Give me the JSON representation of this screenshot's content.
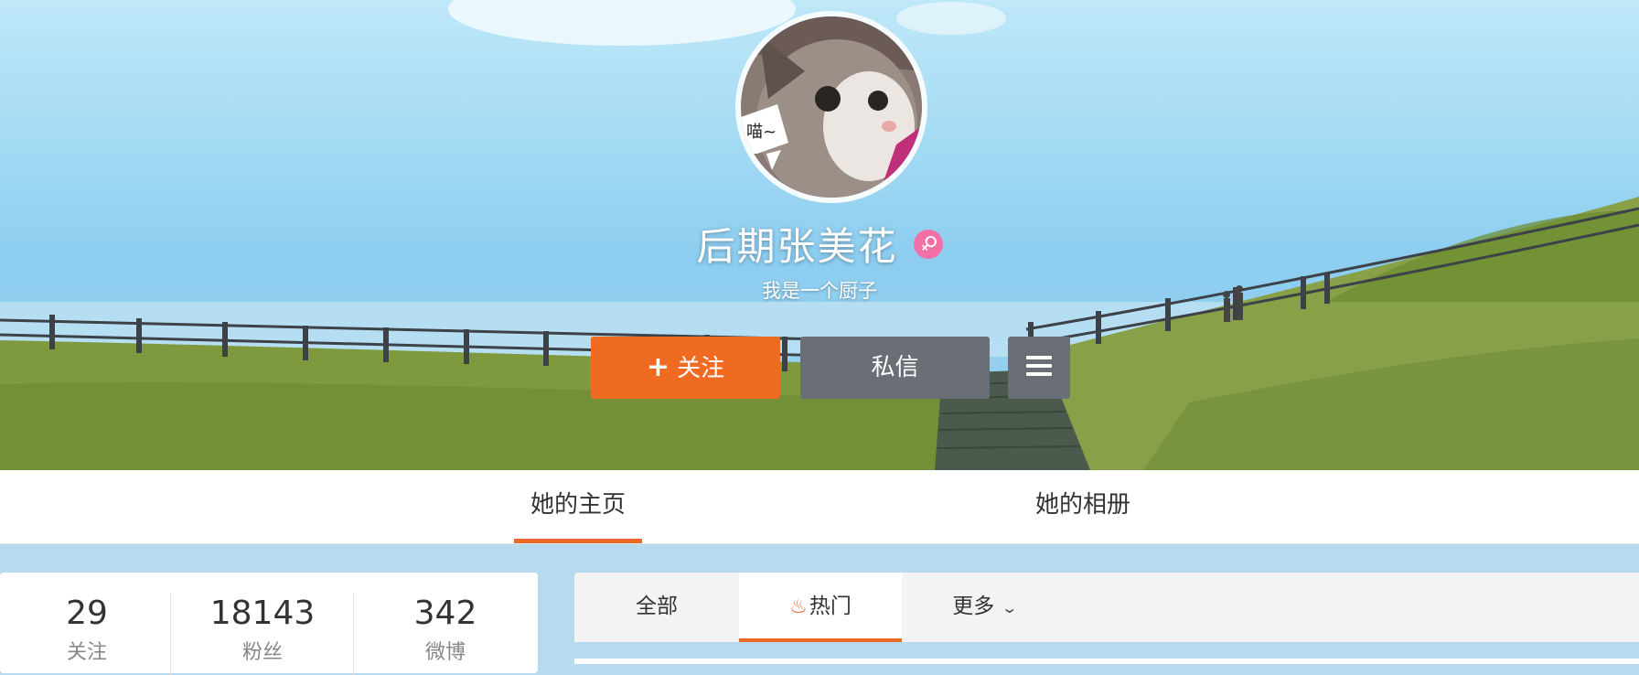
{
  "profile": {
    "name": "后期张美花",
    "bio": "我是一个厨子",
    "avatar_bubble_text": "喵~",
    "gender_icon": "female-icon"
  },
  "actions": {
    "follow_label": "关注",
    "follow_plus": "+",
    "message_label": "私信",
    "more_icon": "hamburger-menu-icon"
  },
  "nav": {
    "tabs": [
      {
        "label": "她的主页",
        "active": true
      },
      {
        "label": "她的相册",
        "active": false
      }
    ]
  },
  "stats": [
    {
      "value": "29",
      "label": "关注"
    },
    {
      "value": "18143",
      "label": "粉丝"
    },
    {
      "value": "342",
      "label": "微博"
    }
  ],
  "feed": {
    "tabs": [
      {
        "label": "全部",
        "active": false
      },
      {
        "label": "热门",
        "active": true,
        "icon": "flame-icon"
      },
      {
        "label": "更多",
        "active": false,
        "icon": "chevron-down-icon"
      }
    ]
  },
  "colors": {
    "accent": "#f06b22",
    "button_gray": "#6a6e77",
    "gender_pink": "#f46fa6"
  }
}
